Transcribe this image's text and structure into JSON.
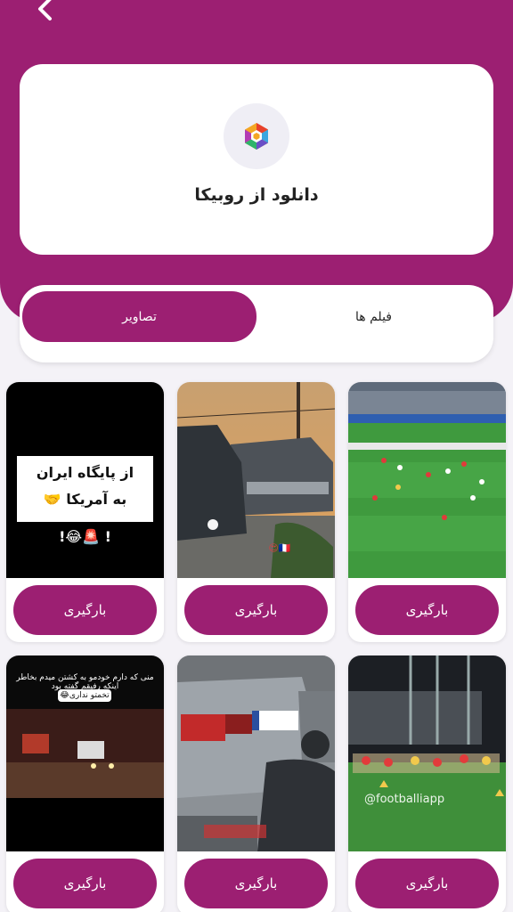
{
  "header": {
    "back_icon": "chevron-left-icon",
    "colors": {
      "primary": "#9c1f72",
      "background": "#f4f2f7"
    }
  },
  "card": {
    "logo_icon": "rubika-logo-icon",
    "title": "دانلود از روبیکا"
  },
  "tabs": [
    {
      "label": "تصاویر",
      "active": true
    },
    {
      "label": "فیلم ها",
      "active": false
    }
  ],
  "items": [
    {
      "button": "بارگیری",
      "caption": ""
    },
    {
      "button": "بارگیری",
      "caption": ""
    },
    {
      "button": "بارگیری",
      "caption_line1": "از پایگاه ایران",
      "caption_line2": "به آمریکا 🤝",
      "caption_line3": "! 🚨😂!"
    },
    {
      "button": "بارگیری",
      "caption": "@footballiapp"
    },
    {
      "button": "بارگیری",
      "caption": ""
    },
    {
      "button": "بارگیری",
      "caption_line1": "منی که دارم خودمو به کشتن میدم بخاطر اینکه رفیقم گفته بود",
      "caption_line2": "تخمتو نداری😂"
    }
  ]
}
